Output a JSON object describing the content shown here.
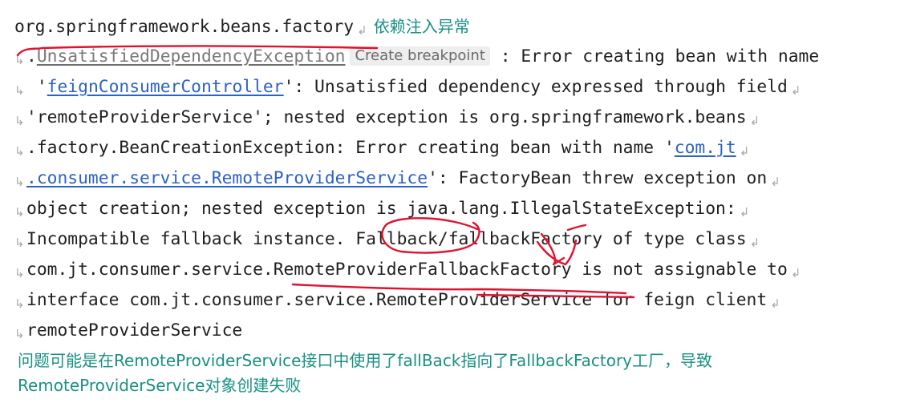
{
  "console": {
    "line1": {
      "text": "org.springframework.beans.factory",
      "annotation": "依赖注入异常"
    },
    "line2": {
      "dot": ".",
      "exception_link": "UnsatisfiedDependencyException",
      "breakpoint_chip": "Create breakpoint",
      "rest": " : Error creating bean with name"
    },
    "line3": {
      "pre": " '",
      "bean_link": "feignConsumerController",
      "rest": "': Unsatisfied dependency expressed through field"
    },
    "line4": {
      "text": "'remoteProviderService'; nested exception is org.springframework.beans"
    },
    "line5": {
      "text": ".factory.BeanCreationException: Error creating bean with name '",
      "link": "com.jt"
    },
    "line6": {
      "link": ".consumer.service.RemoteProviderService",
      "rest": "': FactoryBean threw exception on"
    },
    "line7": {
      "text": "object creation; nested exception is java.lang.IllegalStateException:"
    },
    "line8": {
      "text": "Incompatible fallback instance. Fallback/fallbackFactory of type class"
    },
    "line9": {
      "text": "com.jt.consumer.service.RemoteProviderFallbackFactory is not assignable to"
    },
    "line10": {
      "text": "interface com.jt.consumer.service.RemoteProviderService for feign client"
    },
    "line11": {
      "text": "remoteProviderService"
    }
  },
  "notes": {
    "line1": "问题可能是在RemoteProviderService接口中使用了fallBack指向了FallbackFactory工厂，导致",
    "line2": "RemoteProviderService对象创建失败"
  },
  "icons": {
    "soft_wrap": "soft-wrap-icon"
  },
  "colors": {
    "text": "#1f1f1f",
    "link": "#2c62c4",
    "annotation": "#199083",
    "ink": "#e0122f",
    "chip_bg": "#eeeeee"
  }
}
